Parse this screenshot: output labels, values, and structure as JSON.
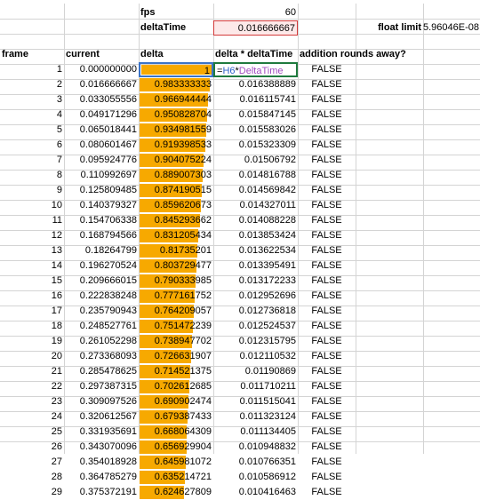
{
  "params": {
    "fps_label": "fps",
    "fps_value": "60",
    "deltatime_label": "deltaTime",
    "deltatime_value": "0.016666667",
    "float_limit_label": "float limit",
    "float_limit_value": "5.96046E-08"
  },
  "headers": {
    "frame": "frame",
    "current": "current",
    "delta": "delta",
    "delta_x_dt": "delta * deltaTime",
    "rounds_away": "addition rounds away?"
  },
  "formula": {
    "equals": "=",
    "ref_h": "H6",
    "op": "*",
    "ref_dt": "DeltaTime"
  },
  "colors": {
    "databar": "#f7a900",
    "highlight_fill": "#fde9e9",
    "highlight_border": "#d33a3a",
    "formula_border": "#1f7a3e",
    "gridline": "#d4d4d4"
  },
  "rows": [
    {
      "frame": "1",
      "current": "0.000000000",
      "delta": "1",
      "delta_dt": "",
      "rounds": "FALSE",
      "delta_num": 1.0
    },
    {
      "frame": "2",
      "current": "0.016666667",
      "delta": "0.983333333",
      "delta_dt": "0.016388889",
      "rounds": "FALSE",
      "delta_num": 0.983333333
    },
    {
      "frame": "3",
      "current": "0.033055556",
      "delta": "0.966944444",
      "delta_dt": "0.016115741",
      "rounds": "FALSE",
      "delta_num": 0.966944444
    },
    {
      "frame": "4",
      "current": "0.049171296",
      "delta": "0.950828704",
      "delta_dt": "0.015847145",
      "rounds": "FALSE",
      "delta_num": 0.950828704
    },
    {
      "frame": "5",
      "current": "0.065018441",
      "delta": "0.934981559",
      "delta_dt": "0.015583026",
      "rounds": "FALSE",
      "delta_num": 0.934981559
    },
    {
      "frame": "6",
      "current": "0.080601467",
      "delta": "0.919398533",
      "delta_dt": "0.015323309",
      "rounds": "FALSE",
      "delta_num": 0.919398533
    },
    {
      "frame": "7",
      "current": "0.095924776",
      "delta": "0.904075224",
      "delta_dt": "0.01506792",
      "rounds": "FALSE",
      "delta_num": 0.904075224
    },
    {
      "frame": "8",
      "current": "0.110992697",
      "delta": "0.889007303",
      "delta_dt": "0.014816788",
      "rounds": "FALSE",
      "delta_num": 0.889007303
    },
    {
      "frame": "9",
      "current": "0.125809485",
      "delta": "0.874190515",
      "delta_dt": "0.014569842",
      "rounds": "FALSE",
      "delta_num": 0.874190515
    },
    {
      "frame": "10",
      "current": "0.140379327",
      "delta": "0.859620673",
      "delta_dt": "0.014327011",
      "rounds": "FALSE",
      "delta_num": 0.859620673
    },
    {
      "frame": "11",
      "current": "0.154706338",
      "delta": "0.845293662",
      "delta_dt": "0.014088228",
      "rounds": "FALSE",
      "delta_num": 0.845293662
    },
    {
      "frame": "12",
      "current": "0.168794566",
      "delta": "0.831205434",
      "delta_dt": "0.013853424",
      "rounds": "FALSE",
      "delta_num": 0.831205434
    },
    {
      "frame": "13",
      "current": "0.18264799",
      "delta": "0.81735201",
      "delta_dt": "0.013622534",
      "rounds": "FALSE",
      "delta_num": 0.81735201
    },
    {
      "frame": "14",
      "current": "0.196270524",
      "delta": "0.803729477",
      "delta_dt": "0.013395491",
      "rounds": "FALSE",
      "delta_num": 0.803729477
    },
    {
      "frame": "15",
      "current": "0.209666015",
      "delta": "0.790333985",
      "delta_dt": "0.013172233",
      "rounds": "FALSE",
      "delta_num": 0.790333985
    },
    {
      "frame": "16",
      "current": "0.222838248",
      "delta": "0.777161752",
      "delta_dt": "0.012952696",
      "rounds": "FALSE",
      "delta_num": 0.777161752
    },
    {
      "frame": "17",
      "current": "0.235790943",
      "delta": "0.764209057",
      "delta_dt": "0.012736818",
      "rounds": "FALSE",
      "delta_num": 0.764209057
    },
    {
      "frame": "18",
      "current": "0.248527761",
      "delta": "0.751472239",
      "delta_dt": "0.012524537",
      "rounds": "FALSE",
      "delta_num": 0.751472239
    },
    {
      "frame": "19",
      "current": "0.261052298",
      "delta": "0.738947702",
      "delta_dt": "0.012315795",
      "rounds": "FALSE",
      "delta_num": 0.738947702
    },
    {
      "frame": "20",
      "current": "0.273368093",
      "delta": "0.726631907",
      "delta_dt": "0.012110532",
      "rounds": "FALSE",
      "delta_num": 0.726631907
    },
    {
      "frame": "21",
      "current": "0.285478625",
      "delta": "0.714521375",
      "delta_dt": "0.01190869",
      "rounds": "FALSE",
      "delta_num": 0.714521375
    },
    {
      "frame": "22",
      "current": "0.297387315",
      "delta": "0.702612685",
      "delta_dt": "0.011710211",
      "rounds": "FALSE",
      "delta_num": 0.702612685
    },
    {
      "frame": "23",
      "current": "0.309097526",
      "delta": "0.690902474",
      "delta_dt": "0.011515041",
      "rounds": "FALSE",
      "delta_num": 0.690902474
    },
    {
      "frame": "24",
      "current": "0.320612567",
      "delta": "0.679387433",
      "delta_dt": "0.011323124",
      "rounds": "FALSE",
      "delta_num": 0.679387433
    },
    {
      "frame": "25",
      "current": "0.331935691",
      "delta": "0.668064309",
      "delta_dt": "0.011134405",
      "rounds": "FALSE",
      "delta_num": 0.668064309
    },
    {
      "frame": "26",
      "current": "0.343070096",
      "delta": "0.656929904",
      "delta_dt": "0.010948832",
      "rounds": "FALSE",
      "delta_num": 0.656929904
    },
    {
      "frame": "27",
      "current": "0.354018928",
      "delta": "0.645981072",
      "delta_dt": "0.010766351",
      "rounds": "FALSE",
      "delta_num": 0.645981072
    },
    {
      "frame": "28",
      "current": "0.364785279",
      "delta": "0.635214721",
      "delta_dt": "0.010586912",
      "rounds": "FALSE",
      "delta_num": 0.635214721
    },
    {
      "frame": "29",
      "current": "0.375372191",
      "delta": "0.624627809",
      "delta_dt": "0.010416463",
      "rounds": "FALSE",
      "delta_num": 0.624627809
    }
  ]
}
